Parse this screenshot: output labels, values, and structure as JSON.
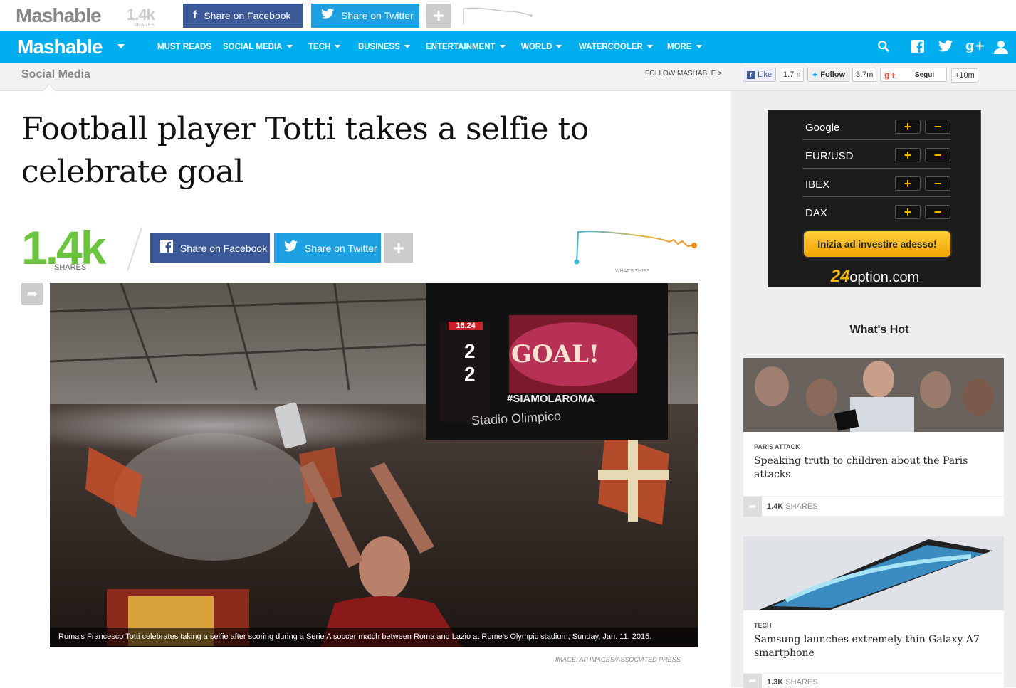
{
  "topbar": {
    "logo": "Mashable",
    "share_count": "1.4k",
    "share_label": "SHARES",
    "facebook_label": "Share on Facebook",
    "twitter_label": "Share on Twitter",
    "plus_label": "+"
  },
  "nav": {
    "brand": "Mashable",
    "items": [
      {
        "label": "MUST READS",
        "has_caret": false
      },
      {
        "label": "SOCIAL MEDIA",
        "has_caret": true
      },
      {
        "label": "TECH",
        "has_caret": true
      },
      {
        "label": "BUSINESS",
        "has_caret": true
      },
      {
        "label": "ENTERTAINMENT",
        "has_caret": true
      },
      {
        "label": "WORLD",
        "has_caret": true
      },
      {
        "label": "WATERCOOLER",
        "has_caret": true
      },
      {
        "label": "MORE",
        "has_caret": true
      }
    ],
    "icons": [
      "search-icon",
      "facebook-icon",
      "twitter-icon",
      "google-plus-icon",
      "user-icon"
    ]
  },
  "subbar": {
    "section": "Social Media",
    "follow": "FOLLOW MASHABLE >",
    "like_label": "Like",
    "like_count": "1.7m",
    "follow_label": "Follow",
    "follow_count": "3.7m",
    "google_label": "Segui",
    "google_count": "+10m"
  },
  "article": {
    "title": "Football player Totti takes a selfie to celebrate goal",
    "share_count": "1.4k",
    "share_label": "SHARES",
    "facebook_label": "Share on Facebook",
    "twitter_label": "Share on Twitter",
    "plus_label": "+",
    "whats_this": "WHAT'S THIS?",
    "caption": "Roma's Francesco Totti celebrates taking a selfie after scoring during a Serie A soccer match between Roma and Lazio at Rome's Olympic stadium, Sunday, Jan. 11, 2015.",
    "credit": "IMAGE: AP IMAGES/ASSOCIATED PRESS",
    "scoreboard": {
      "time": "16.24",
      "score_home": "2",
      "score_away": "2",
      "goal_text": "GOAL!",
      "hashtag": "#SIAMOLAROMA",
      "stadium": "Stadio Olimpico"
    }
  },
  "ad": {
    "rows": [
      "Google",
      "EUR/USD",
      "IBEX",
      "DAX"
    ],
    "cta": "Inizia ad investire adesso!",
    "logo_num": "24",
    "logo_text": "option.com",
    "plus": "+",
    "minus": "−"
  },
  "whats_hot": {
    "title": "What's Hot",
    "cards": [
      {
        "category": "PARIS ATTACK",
        "headline": "Speaking truth to children about the Paris attacks",
        "count": "1.4K",
        "count_label": "SHARES"
      },
      {
        "category": "TECH",
        "headline": "Samsung launches extremely thin Galaxy A7 smartphone",
        "count": "1.3K",
        "count_label": "SHARES"
      }
    ]
  },
  "colors": {
    "nav_blue": "#00aeef",
    "facebook": "#3b5998",
    "twitter": "#1da1e2",
    "shares_green": "#6cc33f",
    "ad_gold": "#f5b800"
  }
}
